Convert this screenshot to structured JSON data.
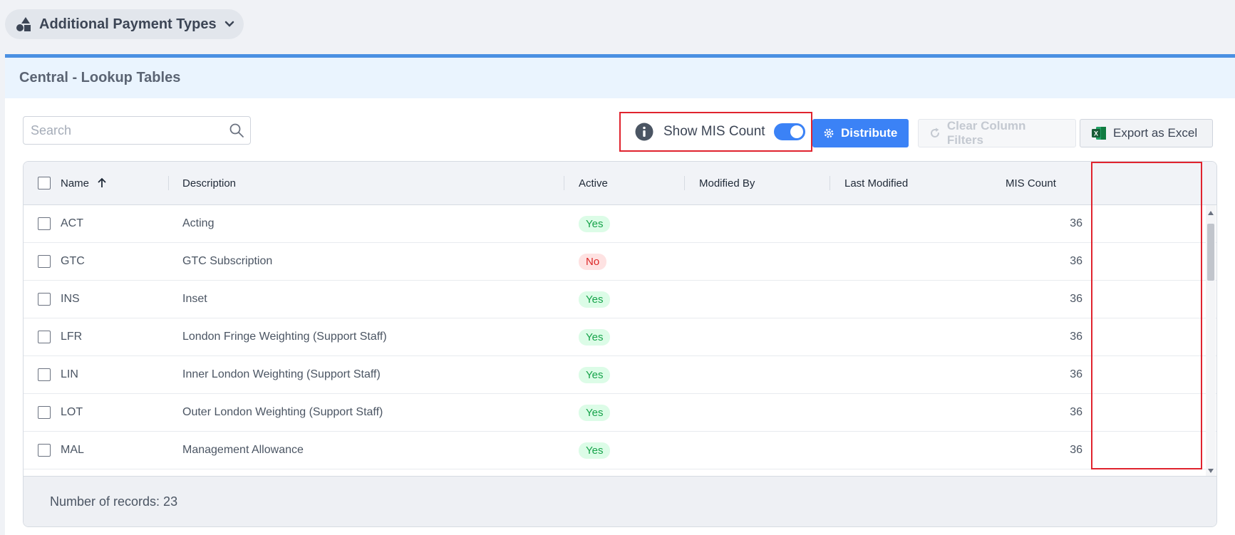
{
  "top": {
    "title": "Additional Payment Types"
  },
  "panel": {
    "title": "Central - Lookup Tables"
  },
  "toolbar": {
    "search_placeholder": "Search",
    "show_mis_label": "Show MIS Count",
    "distribute_label": "Distribute",
    "clear_filters_label": "Clear Column Filters",
    "export_label": "Export as Excel",
    "excel_glyph": "X"
  },
  "grid": {
    "columns": {
      "name": "Name",
      "description": "Description",
      "active": "Active",
      "modified_by": "Modified By",
      "last_modified": "Last Modified",
      "mis_count": "MIS Count"
    },
    "rows": [
      {
        "name": "ACT",
        "description": "Acting",
        "active": "Yes",
        "modified_by": "",
        "last_modified": "",
        "mis_count": "36"
      },
      {
        "name": "GTC",
        "description": "GTC Subscription",
        "active": "No",
        "modified_by": "",
        "last_modified": "",
        "mis_count": "36"
      },
      {
        "name": "INS",
        "description": "Inset",
        "active": "Yes",
        "modified_by": "",
        "last_modified": "",
        "mis_count": "36"
      },
      {
        "name": "LFR",
        "description": "London Fringe Weighting (Support Staff)",
        "active": "Yes",
        "modified_by": "",
        "last_modified": "",
        "mis_count": "36"
      },
      {
        "name": "LIN",
        "description": "Inner London Weighting (Support Staff)",
        "active": "Yes",
        "modified_by": "",
        "last_modified": "",
        "mis_count": "36"
      },
      {
        "name": "LOT",
        "description": "Outer London Weighting (Support Staff)",
        "active": "Yes",
        "modified_by": "",
        "last_modified": "",
        "mis_count": "36"
      },
      {
        "name": "MAL",
        "description": "Management Allowance",
        "active": "Yes",
        "modified_by": "",
        "last_modified": "",
        "mis_count": "36"
      }
    ],
    "footer": "Number of records: 23"
  },
  "colors": {
    "accent": "#3b82f6",
    "highlight": "#e0232e",
    "yes": "#16a34a",
    "no": "#dc2626"
  }
}
